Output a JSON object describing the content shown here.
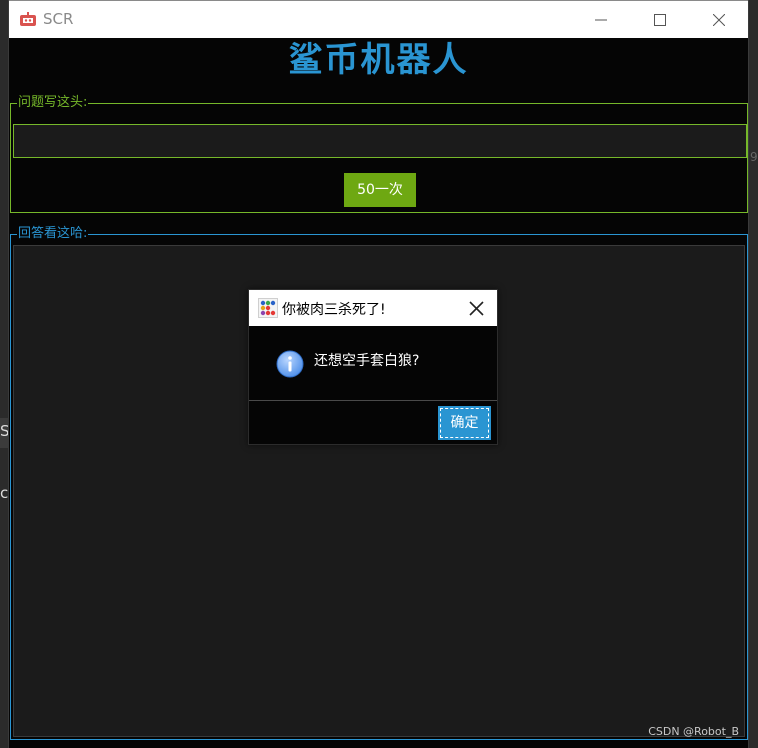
{
  "window": {
    "title": "SCR",
    "heading": "鲨币机器人"
  },
  "question_group": {
    "legend": "问题写这头:",
    "input_value": "",
    "send_label": "50一次"
  },
  "answer_group": {
    "legend": "回答看这哈:",
    "content": ""
  },
  "watermark": "CSDN @Robot_B",
  "dialog": {
    "title": "你被肉三杀死了!",
    "message": "还想空手套白狼?",
    "ok_label": "确定"
  },
  "background": {
    "fragment_1": "S",
    "fragment_2": "c",
    "fragment_3": "9"
  },
  "colors": {
    "accent_green": "#76b82a",
    "accent_blue": "#2a95d2",
    "button_green": "#6ea812",
    "window_bg": "#050505",
    "field_bg": "#1b1b1b"
  },
  "icons": [
    "app-icon",
    "minimize-icon",
    "maximize-icon",
    "close-icon",
    "dialog-app-icon",
    "info-icon"
  ]
}
